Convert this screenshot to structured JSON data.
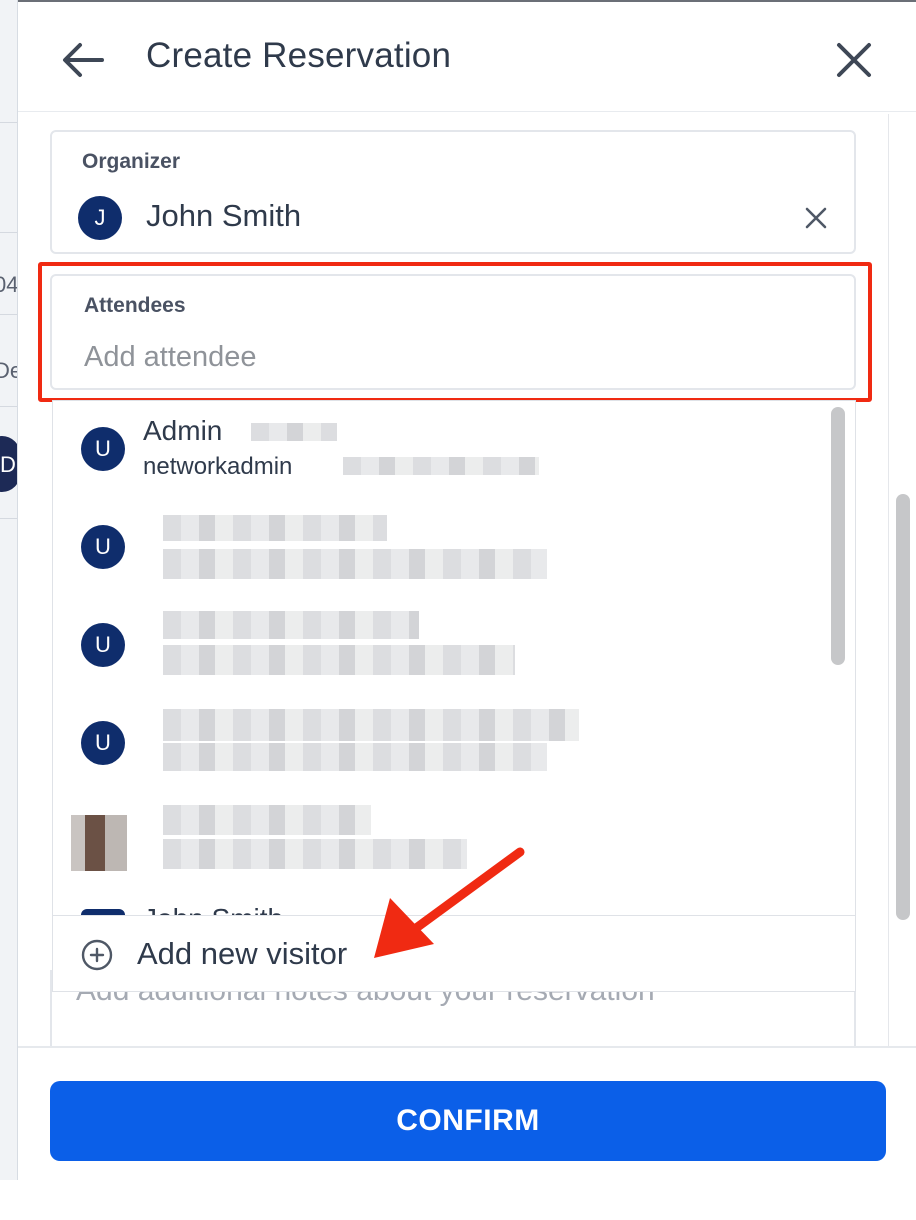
{
  "background": {
    "fragments": [
      "04",
      "De",
      "D"
    ]
  },
  "header": {
    "title": "Create Reservation",
    "back_icon": "arrow-left-icon",
    "close_icon": "close-icon"
  },
  "organizer": {
    "label": "Organizer",
    "avatar_initial": "J",
    "name": "John Smith",
    "clear_icon": "close-icon"
  },
  "attendees": {
    "label": "Attendees",
    "placeholder": "Add attendee",
    "value": ""
  },
  "dropdown": {
    "items": [
      {
        "initial": "U",
        "name": "Admin",
        "email": "networkadmin"
      },
      {
        "initial": "U",
        "name": "",
        "email": ""
      },
      {
        "initial": "U",
        "name": "",
        "email": ""
      },
      {
        "initial": "U",
        "name": "",
        "email": ""
      },
      {
        "initial": "",
        "name": "",
        "email": ""
      }
    ],
    "partial_item_name": "John Smith",
    "add_visitor_label": "Add new visitor",
    "add_visitor_icon": "plus-circle-icon"
  },
  "notes": {
    "placeholder": "Add additional notes about your reservation"
  },
  "footer": {
    "confirm_label": "CONFIRM"
  },
  "colors": {
    "primary": "#0b5fe8",
    "avatar": "#0f2d6c",
    "highlight": "#f02a12",
    "text": "#2f3a4b"
  }
}
